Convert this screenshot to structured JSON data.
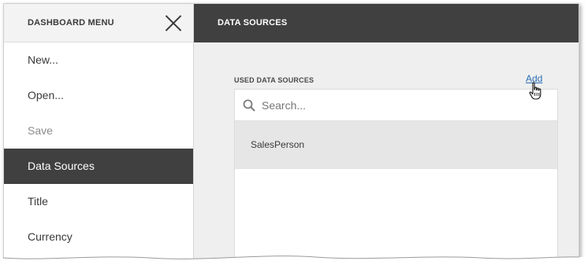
{
  "menu": {
    "title": "DASHBOARD MENU",
    "items": [
      {
        "label": "New...",
        "state": "normal"
      },
      {
        "label": "Open...",
        "state": "normal"
      },
      {
        "label": "Save",
        "state": "disabled"
      },
      {
        "label": "Data Sources",
        "state": "active"
      },
      {
        "label": "Title",
        "state": "normal"
      },
      {
        "label": "Currency",
        "state": "normal"
      }
    ]
  },
  "panel": {
    "title": "DATA SOURCES",
    "section_label": "USED DATA SOURCES",
    "add_label": "Add",
    "search": {
      "placeholder": "Search...",
      "value": ""
    },
    "data_sources": [
      "SalesPerson"
    ]
  },
  "colors": {
    "header_dark": "#404040",
    "active_item": "#404040",
    "link": "#2c6db5",
    "selected_row": "#e6e6e6"
  },
  "icons": {
    "close": "close-icon",
    "search": "search-icon",
    "cursor": "hand-cursor-icon"
  }
}
